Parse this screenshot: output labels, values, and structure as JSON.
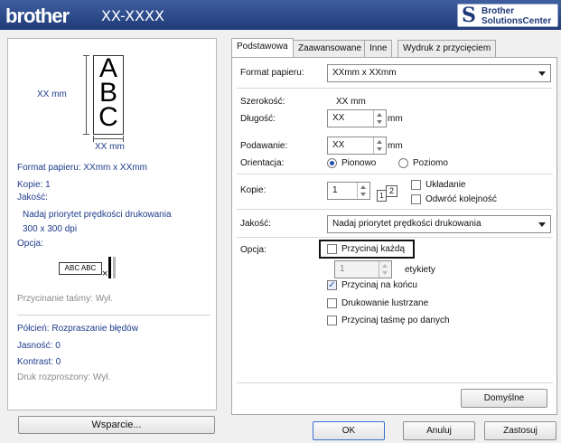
{
  "header": {
    "brand": "brother",
    "model": "XX-XXXX",
    "solutions_line1": "Brother",
    "solutions_line2": "SolutionsCenter"
  },
  "left": {
    "preview_letters": [
      "A",
      "B",
      "C"
    ],
    "dim_height": "XX mm",
    "dim_width": "XX mm",
    "paper_format": "Format papieru:  XXmm x  XXmm",
    "copies": "Kopie: 1",
    "quality_label": "Jakość:",
    "quality_value": "Nadaj priorytet prędkości drukowania",
    "dpi": "300 x 300 dpi",
    "option_label": "Opcja:",
    "abc_mini": "ABC ABC",
    "cut_label": "Przycinanie taśmy: Wył.",
    "halftone": "Półcień: Rozpraszanie błędów",
    "brightness": "Jasność:  0",
    "contrast": "Kontrast:  0",
    "distributed": "Druk rozproszony: Wył.",
    "support_button": "Wsparcie..."
  },
  "tabs": [
    "Podstawowa",
    "Zaawansowane",
    "Inne",
    "Wydruk z przycięciem"
  ],
  "basic": {
    "paper_format_label": "Format papieru:",
    "paper_format_value": "XXmm x  XXmm",
    "width_label": "Szerokość:",
    "width_value": "XX mm",
    "length_label": "Długość:",
    "length_value": "XX",
    "length_unit": "mm",
    "feed_label": "Podawanie:",
    "feed_value": "XX",
    "feed_unit": "mm",
    "orientation_label": "Orientacja:",
    "orientation_portrait": "Pionowo",
    "orientation_landscape": "Poziomo",
    "copies_label": "Kopie:",
    "copies_value": "1",
    "collate": "Układanie",
    "reverse": "Odwróć kolejność",
    "quality_label": "Jakość:",
    "quality_value": "Nadaj priorytet prędkości drukowania",
    "option_label": "Opcja:",
    "cut_every": "Przycinaj każdą",
    "labels_value": "1",
    "labels_unit": "etykiety",
    "cut_at_end": "Przycinaj na końcu",
    "mirror": "Drukowanie lustrzane",
    "cut_after_data": "Przycinaj taśmę po danych",
    "default_button": "Domyślne"
  },
  "footer": {
    "ok": "OK",
    "cancel": "Anuluj",
    "apply": "Zastosuj"
  }
}
